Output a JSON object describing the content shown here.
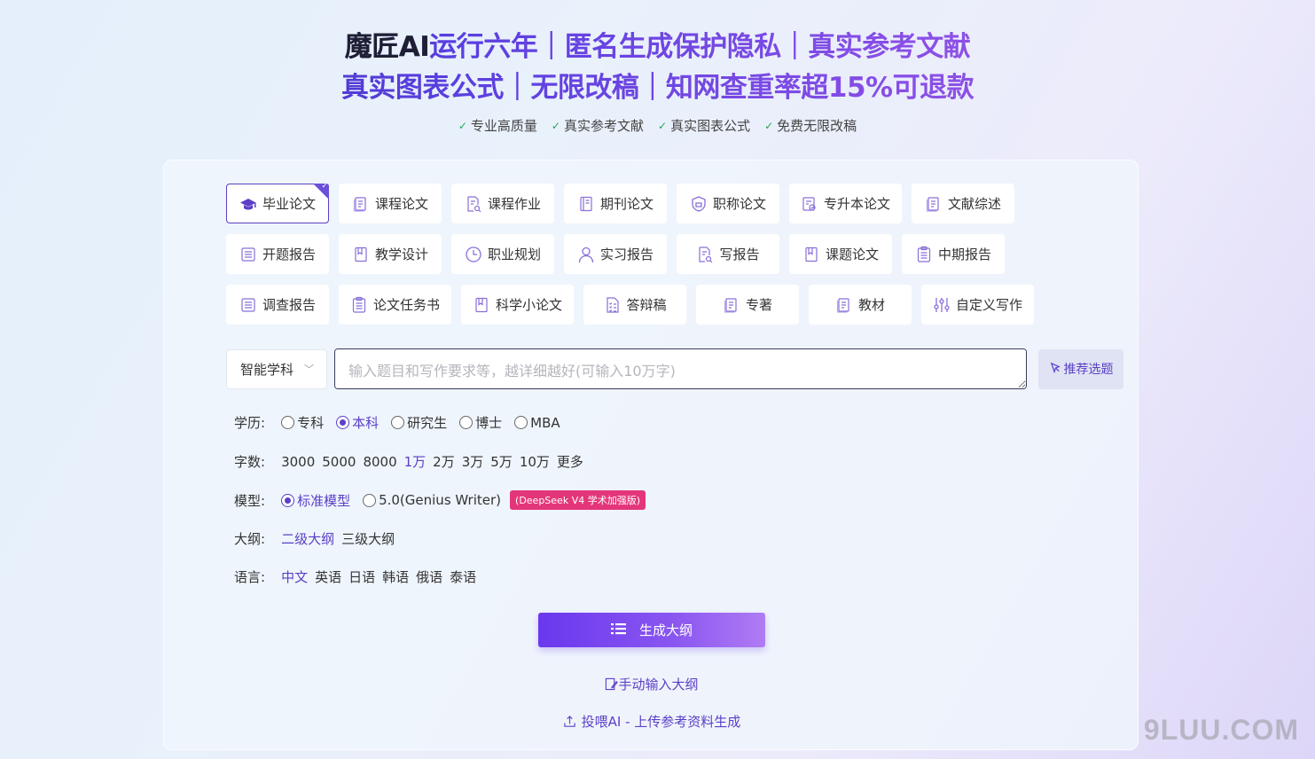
{
  "hero": {
    "brand": "魔匠AI",
    "line1_rest": "运行六年｜匿名生成保护隐私｜真实参考文献",
    "line2": "真实图表公式｜无限改稿｜知网查重率超15%可退款"
  },
  "features": [
    "专业高质量",
    "真实参考文献",
    "真实图表公式",
    "免费无限改稿"
  ],
  "paper_types": [
    [
      {
        "label": "毕业论文",
        "icon": "graduation-cap-icon",
        "active": true
      },
      {
        "label": "课程论文",
        "icon": "document-icon"
      },
      {
        "label": "课程作业",
        "icon": "document-search-icon"
      },
      {
        "label": "期刊论文",
        "icon": "journal-icon"
      },
      {
        "label": "职称论文",
        "icon": "shield-icon"
      },
      {
        "label": "专升本论文",
        "icon": "document-check-icon"
      },
      {
        "label": "文献综述",
        "icon": "document-icon"
      }
    ],
    [
      {
        "label": "开题报告",
        "icon": "report-icon"
      },
      {
        "label": "教学设计",
        "icon": "book-icon"
      },
      {
        "label": "职业规划",
        "icon": "clock-icon"
      },
      {
        "label": "实习报告",
        "icon": "user-icon"
      },
      {
        "label": "写报告",
        "icon": "document-search-icon"
      },
      {
        "label": "课题论文",
        "icon": "book-icon"
      },
      {
        "label": "中期报告",
        "icon": "clipboard-icon"
      }
    ],
    [
      {
        "label": "调查报告",
        "icon": "report-icon"
      },
      {
        "label": "论文任务书",
        "icon": "clipboard-icon"
      },
      {
        "label": "科学小论文",
        "icon": "book-icon"
      },
      {
        "label": "答辩稿",
        "icon": "checklist-icon"
      },
      {
        "label": "专著",
        "icon": "document-icon"
      },
      {
        "label": "教材",
        "icon": "document-icon"
      },
      {
        "label": "自定义写作",
        "icon": "sliders-icon"
      }
    ]
  ],
  "topic": {
    "subject": "智能学科",
    "placeholder": "输入题目和写作要求等，越详细越好(可输入10万字)",
    "recommend": "推荐选题"
  },
  "options": {
    "education": {
      "label": "学历:",
      "items": [
        "专科",
        "本科",
        "研究生",
        "博士",
        "MBA"
      ],
      "selected": 1
    },
    "words": {
      "label": "字数:",
      "items": [
        "3000",
        "5000",
        "8000",
        "1万",
        "2万",
        "3万",
        "5万",
        "10万",
        "更多"
      ],
      "selected": 3
    },
    "model": {
      "label": "模型:",
      "items": [
        "标准模型",
        "5.0(Genius Writer)"
      ],
      "selected": 0,
      "badge": "(DeepSeek V4 学术加强版)"
    },
    "outline": {
      "label": "大纲:",
      "items": [
        "二级大纲",
        "三级大纲"
      ],
      "selected": 0
    },
    "language": {
      "label": "语言:",
      "items": [
        "中文",
        "英语",
        "日语",
        "韩语",
        "俄语",
        "泰语"
      ],
      "selected": 0
    }
  },
  "actions": {
    "generate": "生成大纲",
    "manual": "手动输入大纲",
    "upload": "投喂AI - 上传参考资料生成"
  },
  "watermark": "9LUU.COM",
  "colors": {
    "accent": "#5b3fc6",
    "badge": "#e3367a",
    "check": "#23a559"
  }
}
